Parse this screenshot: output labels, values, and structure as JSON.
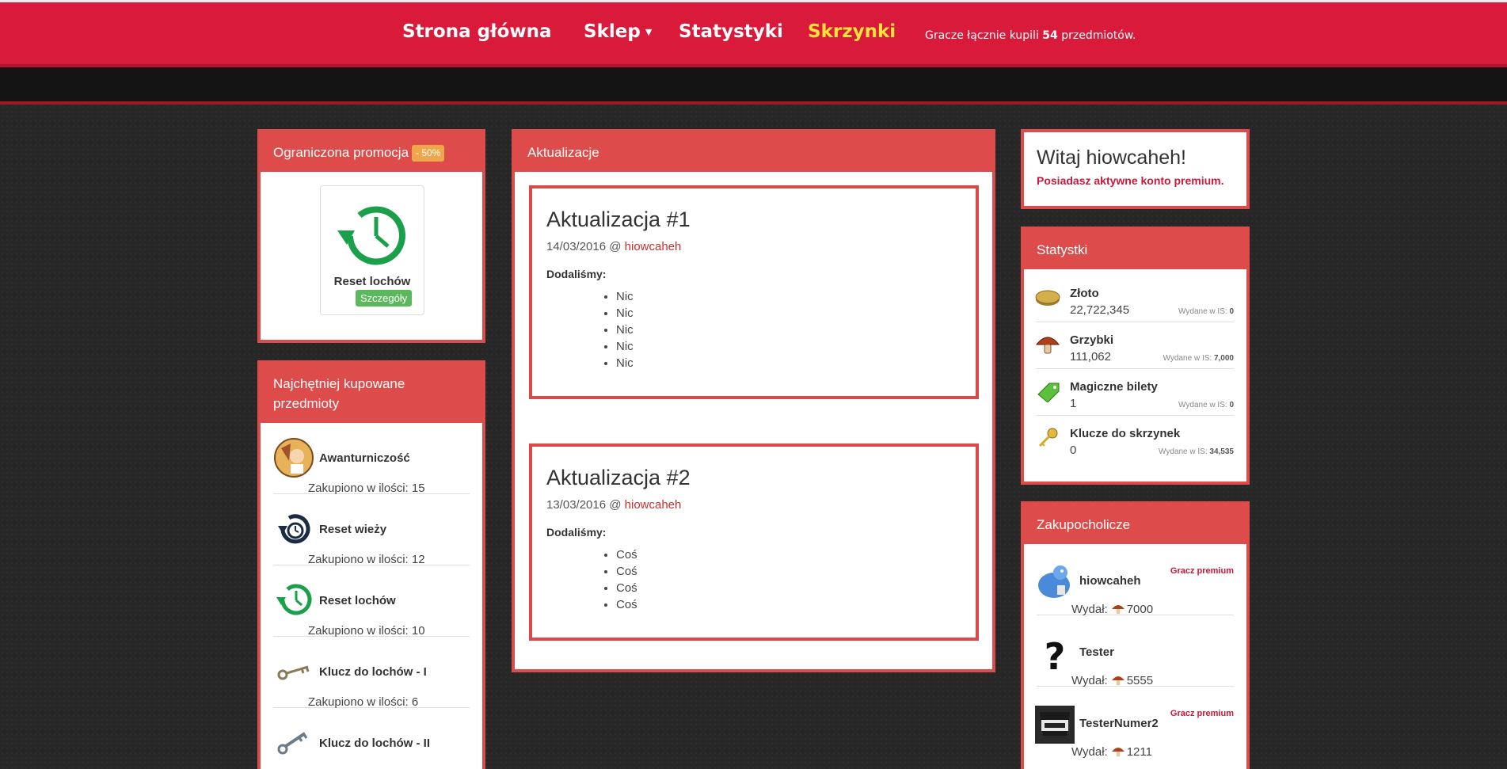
{
  "nav": {
    "home": "Strona główna",
    "shop": "Sklep",
    "stats": "Statystyki",
    "crates": "Skrzynki",
    "purchase_text_before": "Gracze łącznie kupili",
    "purchase_count": "54",
    "purchase_text_after": "przedmiotów."
  },
  "promo": {
    "title": "Ograniczona promocja",
    "discount": "- 50%",
    "item_name": "Reset lochów",
    "details_button": "Szczegóły",
    "icon": "clock-reset-icon"
  },
  "top_items": {
    "title": "Najchętniej kupowane przedmioty",
    "items": [
      {
        "name": "Awanturniczość",
        "quantity": "Zakupiono w ilości: 15",
        "icon": "adventurer-icon"
      },
      {
        "name": "Reset wieży",
        "quantity": "Zakupiono w ilości: 12",
        "icon": "tower-reset-icon"
      },
      {
        "name": "Reset lochów",
        "quantity": "Zakupiono w ilości: 10",
        "icon": "clock-reset-icon"
      },
      {
        "name": "Klucz do lochów - I",
        "quantity": "Zakupiono w ilości: 6",
        "icon": "key-icon"
      },
      {
        "name": "Klucz do lochów - II",
        "quantity": "",
        "icon": "key-icon"
      }
    ]
  },
  "updates": {
    "title": "Aktualizacje",
    "posts": [
      {
        "title": "Aktualizacja #1",
        "date": "14/03/2016 @",
        "author": "hiowcaheh",
        "lead": "Dodaliśmy:",
        "items": [
          "Nic",
          "Nic",
          "Nic",
          "Nic",
          "Nic"
        ]
      },
      {
        "title": "Aktualizacja #2",
        "date": "13/03/2016 @",
        "author": "hiowcaheh",
        "lead": "Dodaliśmy:",
        "items": [
          "Coś",
          "Coś",
          "Coś",
          "Coś"
        ]
      }
    ]
  },
  "welcome": {
    "title": "Witaj hiowcaheh!",
    "subtitle": "Posiadasz aktywne konto premium."
  },
  "stats": {
    "title": "Statystki",
    "spent_label": "Wydane w IS:",
    "rows": [
      {
        "name": "Złoto",
        "value": "22,722,345",
        "spent": "0",
        "icon": "gold-coin-icon"
      },
      {
        "name": "Grzybki",
        "value": "111,062",
        "spent": "7,000",
        "icon": "mushroom-icon"
      },
      {
        "name": "Magiczne bilety",
        "value": "1",
        "spent": "0",
        "icon": "ticket-icon"
      },
      {
        "name": "Klucze do skrzynek",
        "value": "0",
        "spent": "34,535",
        "icon": "key-icon"
      }
    ]
  },
  "buyers": {
    "title": "Zakupocholicze",
    "spent_label": "Wydał:",
    "rows": [
      {
        "name": "hiowcaheh",
        "premium": "Gracz premium",
        "spent": "7000",
        "avatar": "blue-dragon-avatar"
      },
      {
        "name": "Tester",
        "premium": "",
        "spent": "5555",
        "avatar": "question-mark-avatar"
      },
      {
        "name": "TesterNumer2",
        "premium": "Gracz premium",
        "spent": "1211",
        "avatar": "sheriff-avatar"
      }
    ]
  },
  "colors": {
    "nav_bg": "#d91a3b",
    "nav_active": "#ffe23b",
    "panel_red": "#de4b4b",
    "link_red": "#c9302c",
    "premium_red": "#c9183a",
    "success_green": "#5cb85c",
    "discount_orange": "#f0a64a"
  }
}
